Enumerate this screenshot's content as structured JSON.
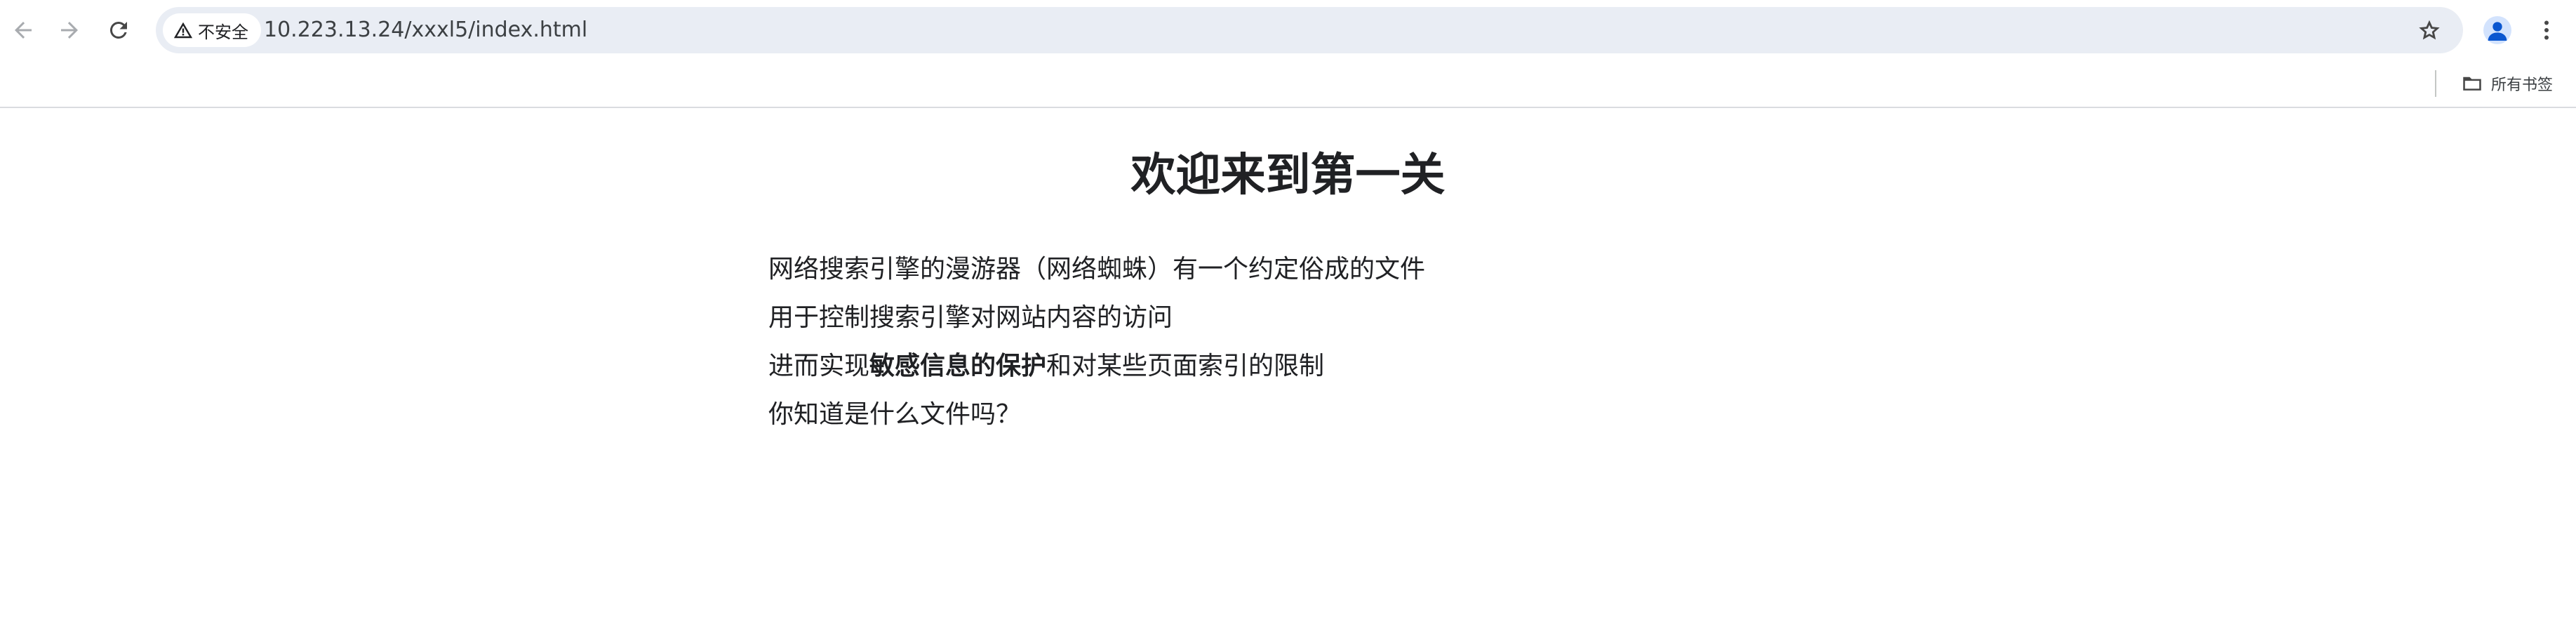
{
  "browser": {
    "back_icon": "arrow-left-icon",
    "forward_icon": "arrow-right-icon",
    "reload_icon": "reload-icon",
    "security_label": "不安全",
    "url": "10.223.13.24/xxxl5/index.html",
    "bookmark_star_icon": "star-outline-icon",
    "profile_icon": "person-icon",
    "menu_icon": "kebab-menu-icon"
  },
  "bookmarks_bar": {
    "all_bookmarks_label": "所有书签",
    "folder_icon": "folder-icon"
  },
  "page": {
    "title": "欢迎来到第一关",
    "line1": "网络搜索引擎的漫游器（网络蜘蛛）有一个约定俗成的文件",
    "line2": "用于控制搜索引擎对网站内容的访问",
    "line3_prefix": "进而实现",
    "line3_bold": "敏感信息的保护",
    "line3_suffix": "和对某些页面索引的限制",
    "line4": "你知道是什么文件吗？"
  },
  "colors": {
    "omnibox_bg": "#e9edf4",
    "text": "#202124",
    "avatar_bg": "#d3e3fd",
    "avatar_fg": "#0b57d0"
  }
}
